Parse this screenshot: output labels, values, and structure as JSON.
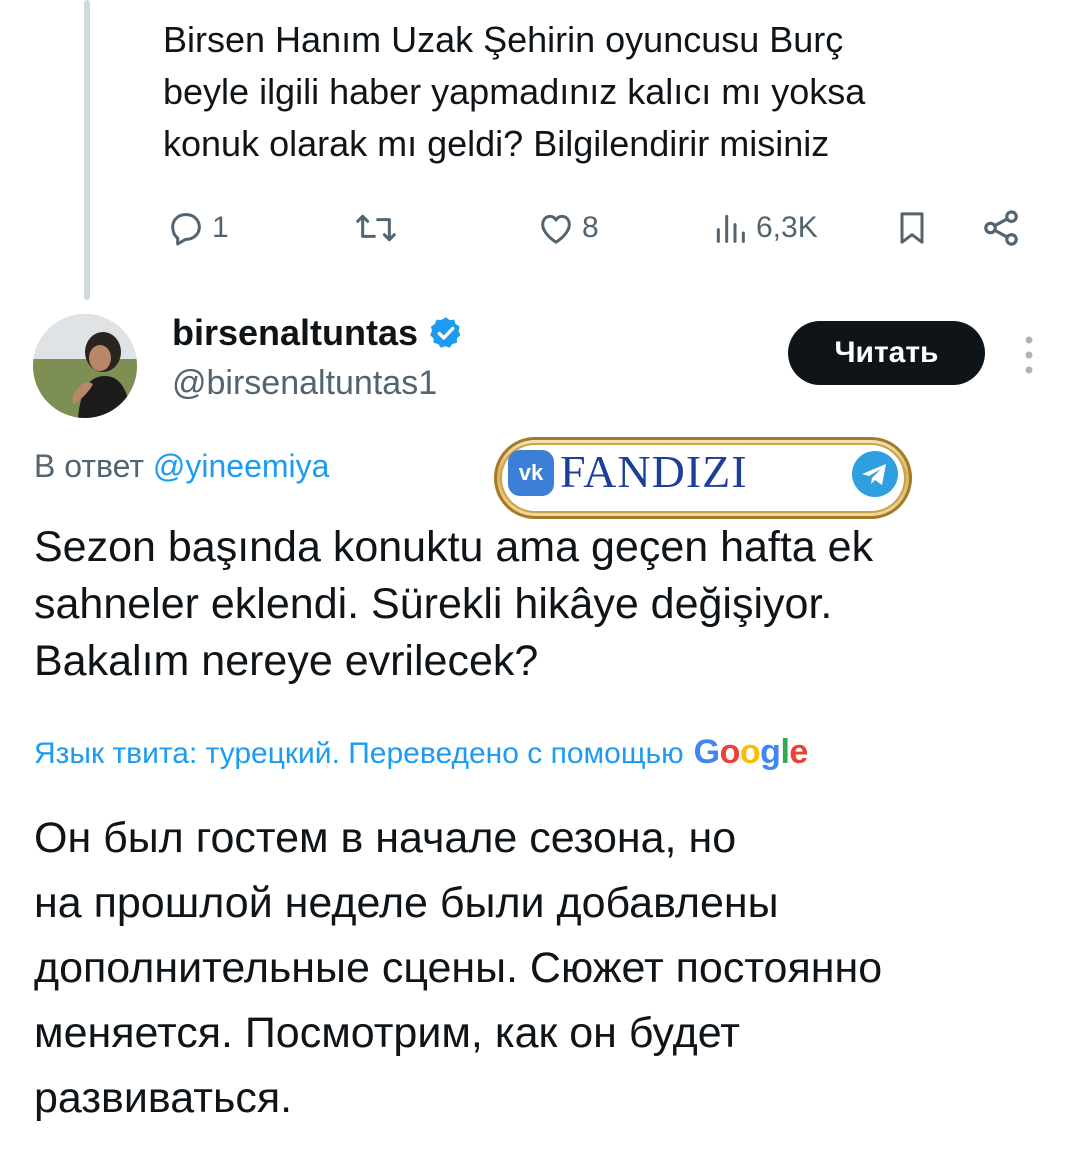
{
  "parent_tweet": {
    "lines": [
      "Birsen Hanım Uzak Şehirin oyuncusu Burç",
      "beyle ilgili haber yapmadınız kalıcı mı yoksa",
      "konuk olarak mı geldi? Bilgilendirir misiniz"
    ],
    "actions": {
      "replies": "1",
      "likes": "8",
      "views": "6,3K"
    },
    "icons": [
      "reply-icon",
      "retweet-icon",
      "like-icon",
      "views-icon",
      "bookmark-icon",
      "share-icon"
    ]
  },
  "reply_tweet": {
    "display_name": "birsenaltuntas",
    "handle": "@birsenaltuntas1",
    "follow_label": "Читать",
    "reply_to_prefix": "В ответ",
    "reply_to_mention": "@yineemiya",
    "text_lines": [
      "Sezon başında konuktu ama geçen hafta ek",
      "sahneler eklendi. Sürekli hikâye değişiyor.",
      "Bakalım nereye evrilecek?"
    ],
    "translation_note": "Язык твита: турецкий. Переведено с помощью",
    "translation_provider": "Google",
    "translated_lines": [
      "Он был гостем в начале сезона, но",
      "на прошлой неделе были добавлены",
      "дополнительные сцены. Сюжет постоянно",
      "меняется. Посмотрим, как он будет",
      "развиваться."
    ]
  },
  "watermark": {
    "text": "FANDIZI",
    "vk_label": "vk"
  },
  "colors": {
    "text": "#0f1419",
    "secondary": "#536471",
    "accent": "#1d9bf0",
    "button": "#0f1419"
  }
}
